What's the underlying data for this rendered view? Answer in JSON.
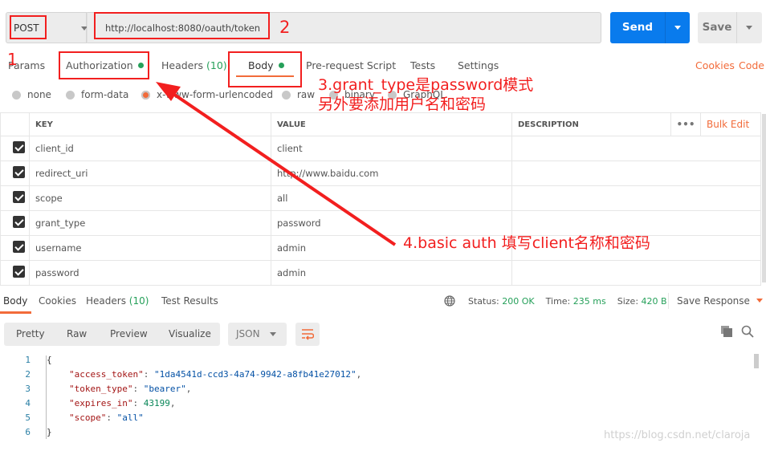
{
  "request": {
    "method": "POST",
    "url": "http://localhost:8080/oauth/token",
    "send_label": "Send",
    "save_label": "Save"
  },
  "tabs": [
    {
      "label": "Params"
    },
    {
      "label": "Authorization",
      "dot": true
    },
    {
      "label": "Headers",
      "count": "(10)"
    },
    {
      "label": "Body",
      "dot": true,
      "active": true
    },
    {
      "label": "Pre-request Script"
    },
    {
      "label": "Tests"
    },
    {
      "label": "Settings"
    }
  ],
  "links": {
    "cookies": "Cookies",
    "code": "Code"
  },
  "body_types": [
    {
      "label": "none"
    },
    {
      "label": "form-data"
    },
    {
      "label": "x-www-form-urlencoded",
      "selected": true
    },
    {
      "label": "raw"
    },
    {
      "label": "binary"
    },
    {
      "label": "GraphQL"
    }
  ],
  "table": {
    "headers": {
      "key": "KEY",
      "value": "VALUE",
      "description": "DESCRIPTION",
      "more": "•••",
      "bulk_edit": "Bulk Edit"
    },
    "rows": [
      {
        "key": "client_id",
        "value": "client"
      },
      {
        "key": "redirect_uri",
        "value": "http://www.baidu.com"
      },
      {
        "key": "scope",
        "value": "all"
      },
      {
        "key": "grant_type",
        "value": "password"
      },
      {
        "key": "username",
        "value": "admin"
      },
      {
        "key": "password",
        "value": "admin"
      }
    ]
  },
  "response": {
    "tabs": [
      {
        "label": "Body"
      },
      {
        "label": "Cookies"
      },
      {
        "label": "Headers",
        "count": "(10)"
      },
      {
        "label": "Test Results"
      }
    ],
    "status_label": "Status:",
    "status": "200 OK",
    "time_label": "Time:",
    "time": "235 ms",
    "size_label": "Size:",
    "size": "420 B",
    "save_response": "Save Response",
    "views": [
      "Pretty",
      "Raw",
      "Preview",
      "Visualize"
    ],
    "format": "JSON",
    "lines": [
      {
        "n": "1",
        "t": "{"
      },
      {
        "n": "2",
        "k": "\"access_token\"",
        "v": "\"1da4541d-ccd3-4a74-9942-a8fb41e27012\"",
        "c": ","
      },
      {
        "n": "3",
        "k": "\"token_type\"",
        "v": "\"bearer\"",
        "c": ","
      },
      {
        "n": "4",
        "k": "\"expires_in\"",
        "num": "43199",
        "c": ","
      },
      {
        "n": "5",
        "k": "\"scope\"",
        "v": "\"all\"",
        "c": ""
      },
      {
        "n": "6",
        "t": "}"
      }
    ]
  },
  "annotations": {
    "n1": "1",
    "n2": "2",
    "n3_line1": "3.grant_type是password模式",
    "n3_line2": "另外要添加用户名和密码",
    "n4": "4.basic auth 填写client名称和密码"
  },
  "watermark": "https://blog.csdn.net/claroja",
  "colors": {
    "accent": "#f26b3a",
    "send": "#097bed",
    "success": "#26a05a",
    "annotation": "#f21f1f"
  }
}
